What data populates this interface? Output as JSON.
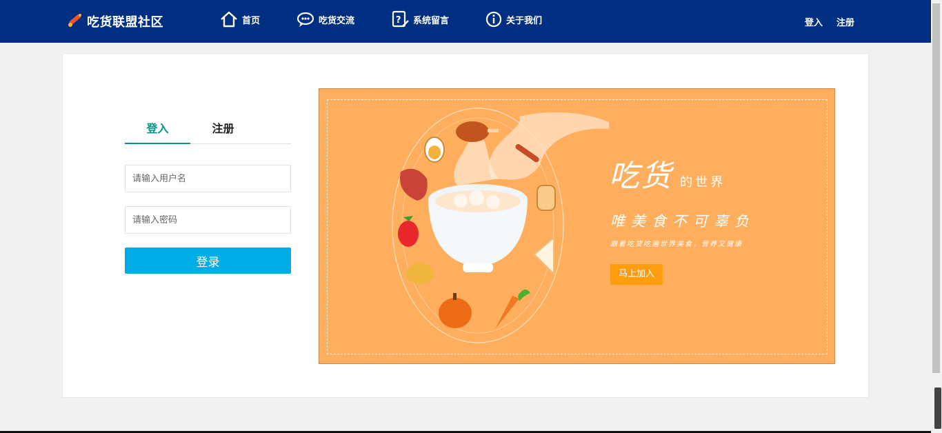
{
  "header": {
    "brand": "吃货联盟社区",
    "nav": [
      {
        "label": "首页",
        "icon": "home-icon"
      },
      {
        "label": "吃货交流",
        "icon": "chat-bubble-icon"
      },
      {
        "label": "系统留言",
        "icon": "message-edit-icon"
      },
      {
        "label": "关于我们",
        "icon": "info-icon"
      }
    ],
    "login": "登入",
    "register": "注册"
  },
  "login_panel": {
    "tabs": [
      "登入",
      "注册"
    ],
    "username_placeholder": "请输入用户名",
    "password_placeholder": "请输入密码",
    "submit": "登录"
  },
  "banner": {
    "title": "吃货",
    "subtitle": "的世界",
    "slogan": "唯美食不可辜负",
    "tagline": "跟着吃货吃遍世界美食，营养又健康",
    "cta": "马上加入"
  },
  "colors": {
    "header_bg": "#002f82",
    "accent": "#009688",
    "button": "#00ade7",
    "banner_bg": "#ffae5e",
    "cta_bg": "#ff9d0f"
  }
}
